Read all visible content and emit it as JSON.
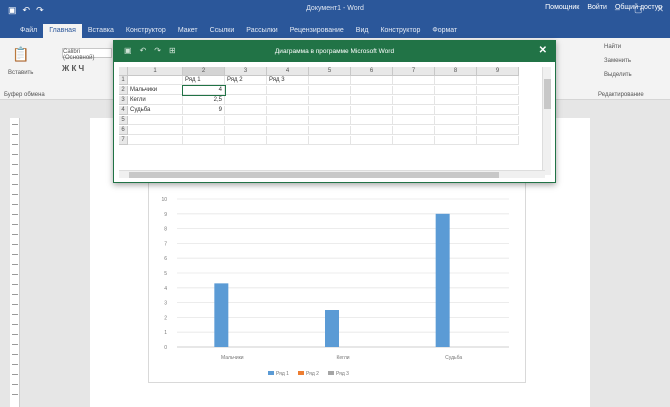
{
  "word": {
    "title": "Документ1 - Word",
    "tabs": [
      "Файл",
      "Главная",
      "Вставка",
      "Конструктор",
      "Макет",
      "Ссылки",
      "Рассылки",
      "Рецензирование",
      "Вид",
      "Конструктор",
      "Формат"
    ],
    "tab_right": [
      "Помощник",
      "Войти",
      "Общий доступ"
    ],
    "ribbon_left": [
      "Вставить",
      "Calibri (Основной)",
      "Буфер обмена"
    ],
    "ribbon_right": [
      "Найти",
      "Заменить",
      "Выделить",
      "Редактирование"
    ]
  },
  "excel": {
    "title": "Диаграмма в программе Microsoft Word",
    "col_headers": [
      "1",
      "2",
      "3",
      "4",
      "5",
      "6",
      "7",
      "8",
      "9"
    ],
    "row_headers": [
      "1",
      "2",
      "3",
      "4",
      "5",
      "6",
      "7"
    ],
    "cells": [
      [
        "",
        "Ряд 1",
        "Ряд 2",
        "Ряд 3"
      ],
      [
        "Мальчики",
        "4",
        "",
        ""
      ],
      [
        "Кегли",
        "2,5",
        "",
        ""
      ],
      [
        "Судьба",
        "9",
        "",
        ""
      ]
    ]
  },
  "chart_data": {
    "type": "bar",
    "title": "",
    "categories": [
      "Мальчики",
      "Кегли",
      "Судьба"
    ],
    "series": [
      {
        "name": "Ряд 1",
        "values": [
          4.3,
          2.5,
          9
        ],
        "color": "#5b9bd5"
      },
      {
        "name": "Ряд 2",
        "values": [
          0,
          0,
          0
        ],
        "color": "#ed7d31"
      },
      {
        "name": "Ряд 3",
        "values": [
          0,
          0,
          0
        ],
        "color": "#a5a5a5"
      }
    ],
    "ylim": [
      0,
      10
    ],
    "yticks": [
      "0",
      "1",
      "2",
      "3",
      "4",
      "5",
      "6",
      "7",
      "8",
      "9",
      "10"
    ],
    "grid": true,
    "legend": "bottom"
  }
}
